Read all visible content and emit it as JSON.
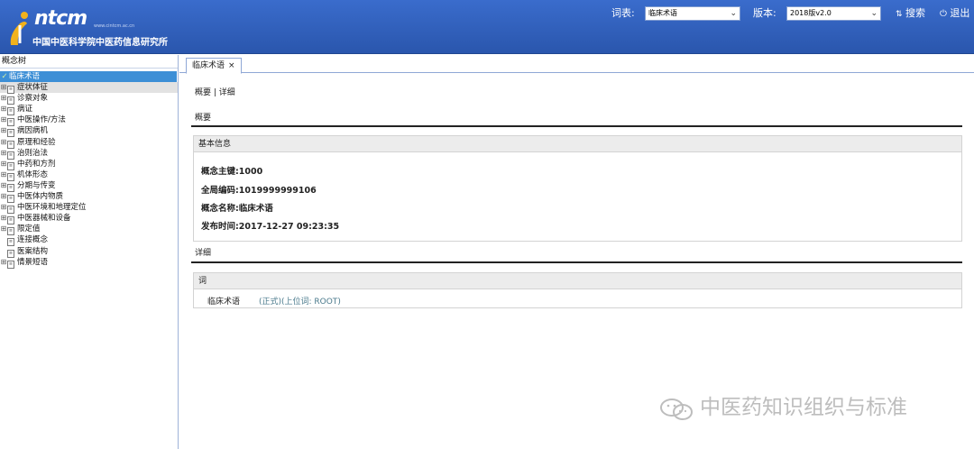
{
  "header": {
    "logo_word": "ntcm",
    "logo_url": "www.cintcm.ac.cn",
    "org_name": "中国中医科学院中医药信息研究所",
    "vocab_label": "词表:",
    "vocab_value": "临床术语",
    "version_label": "版本:",
    "version_value": "2018版v2.0",
    "search_label": "搜索",
    "logout_label": "退出"
  },
  "sidebar": {
    "title": "概念树",
    "root": "临床术语",
    "items": [
      {
        "label": "症状体征",
        "expandable": true
      },
      {
        "label": "诊察对象",
        "expandable": true
      },
      {
        "label": "病证",
        "expandable": true
      },
      {
        "label": "中医操作/方法",
        "expandable": true
      },
      {
        "label": "病因病机",
        "expandable": true
      },
      {
        "label": "原理和经验",
        "expandable": true
      },
      {
        "label": "治则治法",
        "expandable": true
      },
      {
        "label": "中药和方剂",
        "expandable": true
      },
      {
        "label": "机体形态",
        "expandable": true
      },
      {
        "label": "分期与传变",
        "expandable": true
      },
      {
        "label": "中医体内物质",
        "expandable": true
      },
      {
        "label": "中医环境和地理定位",
        "expandable": true
      },
      {
        "label": "中医器械和设备",
        "expandable": true
      },
      {
        "label": "限定值",
        "expandable": true
      },
      {
        "label": "连接概念",
        "expandable": false
      },
      {
        "label": "医案结构",
        "expandable": false
      },
      {
        "label": "情景短语",
        "expandable": true
      }
    ]
  },
  "main": {
    "tab_label": "临床术语",
    "tab_close": "×",
    "breadcrumb": "概要 | 详细",
    "summary_title": "概要",
    "basic_info_title": "基本信息",
    "fields": [
      "概念主键:1000",
      "全局编码:1019999999106",
      "概念名称:临床术语",
      "发布时间:2017-12-27 09:23:35"
    ],
    "detail_title": "详细",
    "term_box_title": "词",
    "term_name": "临床术语",
    "term_meta": "(正式)(上位词: ROOT)"
  },
  "watermark": "中医药知识组织与标准",
  "colors": {
    "header_bg": "#2f5fb8",
    "tree_selected": "#3d8fd6",
    "term_meta": "#4a7a8c"
  }
}
